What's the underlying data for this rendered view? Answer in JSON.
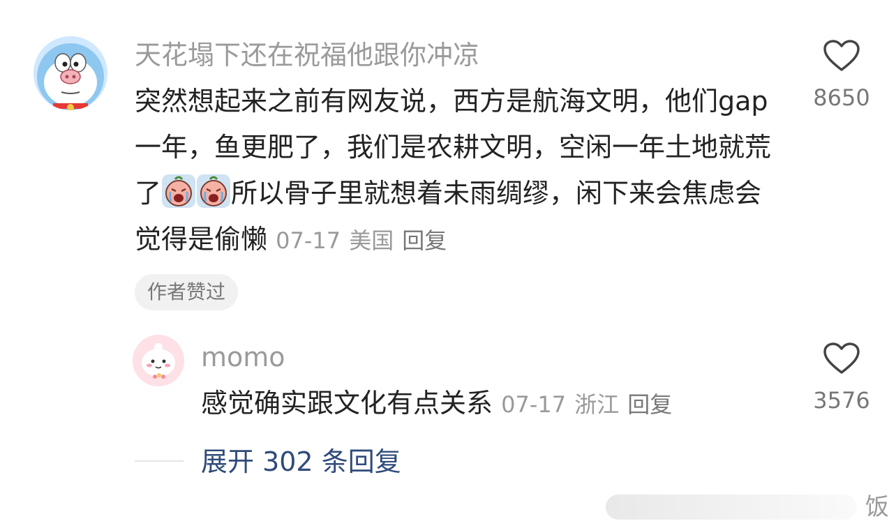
{
  "main_comment": {
    "username": "天花塌下还在祝福他跟你冲凉",
    "text_part1": "突然想起来之前有网友说，西方是航海文明，他们gap一年，鱼更肥了，我们是农耕文明，空闲一年土地就荒了",
    "emoji_1": "crying-face-emoji",
    "emoji_2": "crying-face-emoji",
    "text_part2": "所以骨子里就想着未雨绸缪，闲下来会焦虑会觉得是偷懒",
    "date": "07-17",
    "location": "美国",
    "reply_label": "回复",
    "like_count": "8650",
    "badge": "作者赞过"
  },
  "reply_comment": {
    "username": "momo",
    "text": "感觉确实跟文化有点关系",
    "date": "07-17",
    "location": "浙江",
    "reply_label": "回复",
    "like_count": "3576"
  },
  "expand": {
    "label": "展开 302 条回复"
  },
  "watermark": {
    "text": "饭"
  },
  "colors": {
    "username": "#9a9a9a",
    "body_text": "#222222",
    "meta": "#999999",
    "expand_link": "#2f4b7a",
    "badge_bg": "#f1f1f1"
  }
}
